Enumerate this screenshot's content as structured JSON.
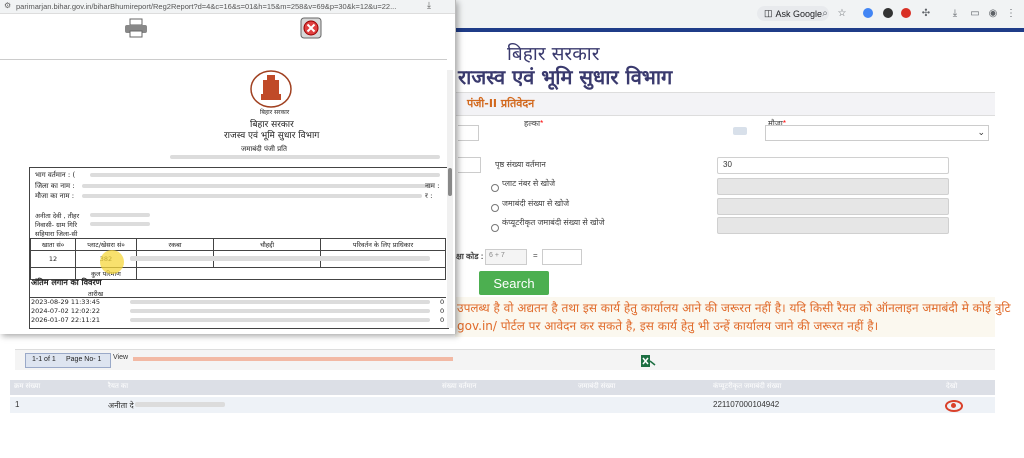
{
  "popup": {
    "url": "parimarjan.bihar.gov.in/biharBhumireport/Reg2Report?d=4&c=16&s=01&h=15&m=258&v=69&p=30&k=12&u=22...",
    "doc_header": {
      "state": "बिहार सरकार",
      "state2": "बिहार सरकार",
      "department": "राजस्व एवं भूमि सुधार विभाग",
      "register": "जमाबंदी पंजी प्रति"
    },
    "fields": {
      "bhag": "भाग वर्तमान : (",
      "district": "जिला का नाम :",
      "mauza": "मौजा का नाम :",
      "right_label1": "नाम :",
      "right_label2": "र :",
      "owner": "अनीता देवी , तीहर",
      "residence": "निवासी- ग्राम गिरि",
      "residence2": "सहियारा जिला-सी"
    },
    "table": {
      "headers": [
        "खाता सं०",
        "प्लाट/खेसरा सं०",
        "रकबा",
        "चौहद्दी",
        "परिवर्तन के लिए प्राधिकार"
      ],
      "row": {
        "khata": "12",
        "plot": "382"
      },
      "total_label": "कुल परिमाण"
    },
    "tax_title": "अंतिम लगान का विवरण",
    "date_header": "तारीख",
    "dates": [
      "2023-08-29 11:33:45",
      "2024-07-02 12:02:22",
      "2026-01-07 22:11:21"
    ],
    "date_values": [
      "0",
      "0",
      "0"
    ]
  },
  "browser": {
    "ask_google": "Ask Google",
    "icon_colors": {
      "blue": "#4285f4",
      "red": "#d93025",
      "dark": "#333333"
    }
  },
  "page": {
    "header_line1": "बिहार सरकार",
    "header_line2": "राजस्व एवं भूमि सुधार विभाग",
    "title": "पंजी-II प्रतिवेदन",
    "halka_label": "हल्का",
    "mauza_label": "मौजा",
    "page_no_label": "पृष्ठ संख्या वर्तमान",
    "page_no_value": "30",
    "options": [
      "प्लाट नंबर से खोजे",
      "जमाबंदी संख्या से खोजे",
      "कंप्यूटरीकृत जमाबंदी संख्या से खोजे"
    ],
    "captcha_label": "क्षा कोड :",
    "captcha_question": "6 + 7",
    "captcha_eq": "=",
    "search_button": "Search",
    "notice_line1": "उपलब्ध है वो अद्यतन है तथा इस कार्य हेतु कार्यालय आने की जरूरत नहीं है। यदि किसी रैयत को ऑनलाइन जमाबंदी मे कोई त्रुटि",
    "notice_line2": "gov.in/ पोर्टल पर आवेदन कर सकते है, इस कार्य हेतु भी उन्हें कार्यालय जाने की जरूरत नहीं है।",
    "pager": {
      "range": "1-1 of 1",
      "page": "Page No- 1",
      "view": "View"
    },
    "columns": [
      "क्रम संख्या",
      "रैयत का",
      "संख्या वर्तमान",
      "जमाबंदी संख्या",
      "कंप्यूटरीकृत जमाबंदी संख्या",
      "देखो"
    ],
    "row": {
      "serial": "1",
      "raiyat": "अनीता दे",
      "computerized_no": "221107000104942"
    }
  },
  "colors": {
    "accent_green": "#4caf50",
    "notice_orange": "#e06a2a",
    "header_navy": "#3a3a6e",
    "view_red": "#d9412b"
  }
}
